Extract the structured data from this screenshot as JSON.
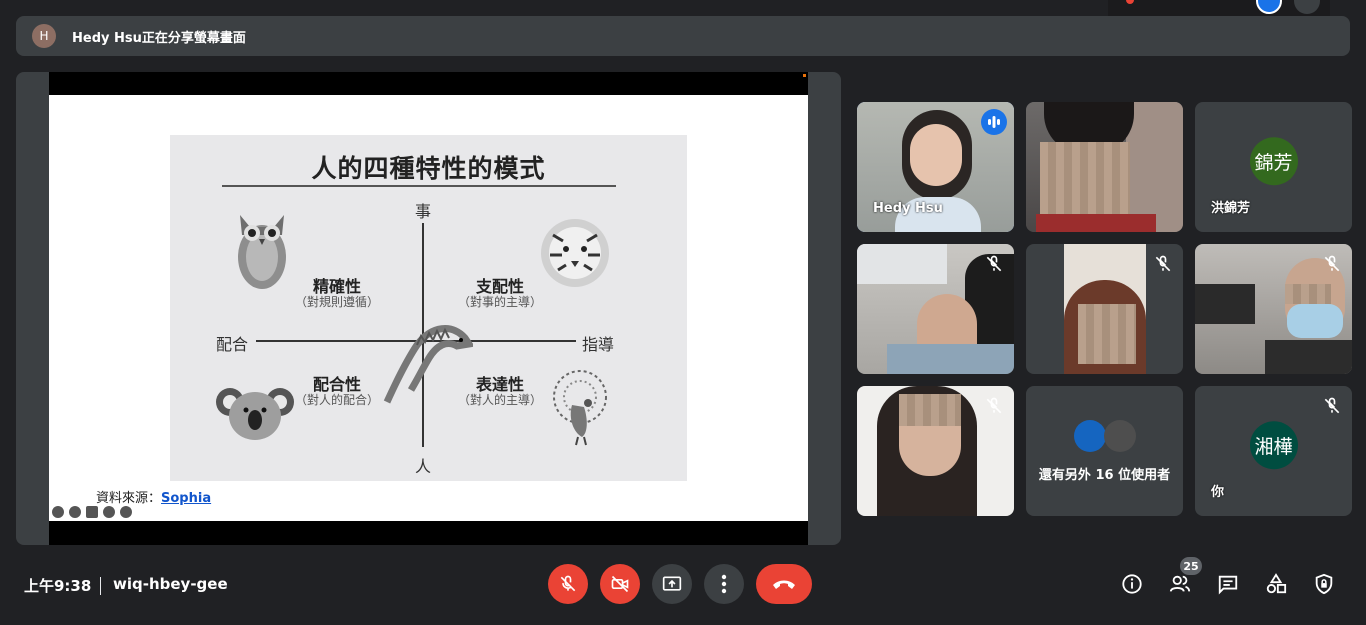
{
  "share_bar": {
    "avatar_initial": "H",
    "text": "Hedy Hsu正在分享螢幕畫面"
  },
  "slide": {
    "title": "人的四種特性的模式",
    "axis_top": "事",
    "axis_bottom": "人",
    "axis_left": "配合",
    "axis_right": "指導",
    "quadrants": [
      {
        "title": "精確性",
        "subtitle": "（對規則遵循）"
      },
      {
        "title": "支配性",
        "subtitle": "（對事的主導）"
      },
      {
        "title": "配合性",
        "subtitle": "（對人的配合）"
      },
      {
        "title": "表達性",
        "subtitle": "（對人的主導）"
      }
    ],
    "source_label": "資料來源：",
    "source_link": "Sophia"
  },
  "participants": [
    {
      "name": "Hedy Hsu",
      "active": true
    },
    {
      "name": "",
      "active": false
    },
    {
      "name": "洪錦芳",
      "avatar_text": "錦芳",
      "avatar_color": "#33691e"
    },
    {
      "name": "",
      "muted": true
    },
    {
      "name": "",
      "muted": true
    },
    {
      "name": "",
      "muted": true
    },
    {
      "name": "",
      "muted": true
    },
    {
      "name": "還有另外 16 位使用者"
    },
    {
      "name": "你",
      "avatar_text": "湘樺",
      "avatar_color": "#004d40",
      "muted": true
    }
  ],
  "bottom": {
    "time": "上午9:38",
    "meeting_code": "wiq-hbey-gee",
    "people_count": "25"
  },
  "colors": {
    "background": "#202124",
    "panel": "#3c4043",
    "red": "#ea4335",
    "blue": "#1a73e8"
  }
}
